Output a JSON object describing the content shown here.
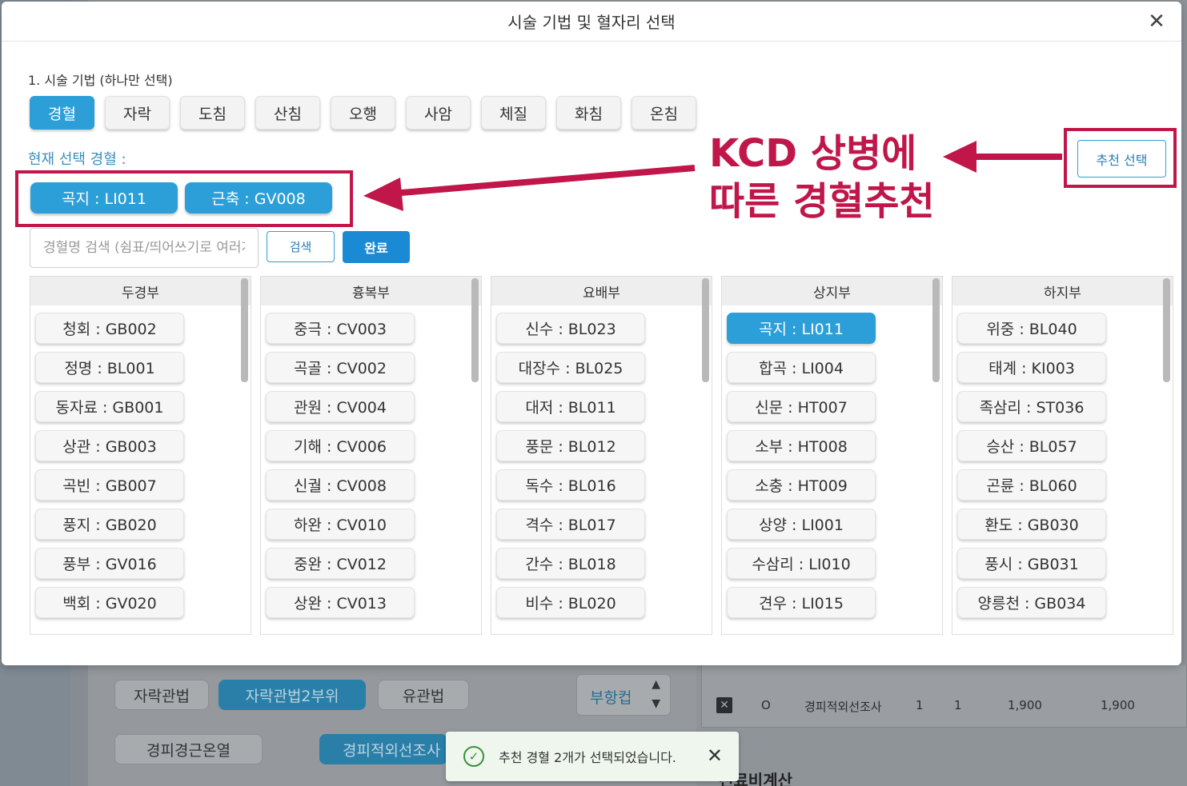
{
  "modal": {
    "title": "시술 기법 및 혈자리 선택",
    "close_icon": "✕"
  },
  "techniques": {
    "label": "1. 시술 기법 (하나만 선택)",
    "items": [
      "경혈",
      "자락",
      "도침",
      "산침",
      "오행",
      "사암",
      "체질",
      "화침",
      "온침"
    ],
    "selected": "경혈"
  },
  "current_selection": {
    "label": "현재 선택 경혈 :",
    "chips": [
      "곡지 : LI011",
      "근축 : GV008"
    ]
  },
  "annotation": {
    "line1": "KCD 상병에",
    "line2": "따른 경혈추천",
    "color": "#c0164a"
  },
  "recommend_button": "추천 선택",
  "search": {
    "placeholder": "경혈명 검색 (쉼표/띄어쓰기로 여러개 검색)",
    "search_label": "검색",
    "done_label": "완료"
  },
  "columns": [
    {
      "title": "두경부",
      "items": [
        "청회 : GB002",
        "정명 : BL001",
        "동자료 : GB001",
        "상관 : GB003",
        "곡빈 : GB007",
        "풍지 : GB020",
        "풍부 : GV016",
        "백회 : GV020"
      ]
    },
    {
      "title": "흉복부",
      "items": [
        "중극 : CV003",
        "곡골 : CV002",
        "관원 : CV004",
        "기해 : CV006",
        "신궐 : CV008",
        "하완 : CV010",
        "중완 : CV012",
        "상완 : CV013"
      ]
    },
    {
      "title": "요배부",
      "items": [
        "신수 : BL023",
        "대장수 : BL025",
        "대저 : BL011",
        "풍문 : BL012",
        "독수 : BL016",
        "격수 : BL017",
        "간수 : BL018",
        "비수 : BL020"
      ]
    },
    {
      "title": "상지부",
      "items": [
        "곡지 : LI011",
        "합곡 : LI004",
        "신문 : HT007",
        "소부 : HT008",
        "소충 : HT009",
        "상양 : LI001",
        "수삼리 : LI010",
        "견우 : LI015"
      ],
      "active": "곡지 : LI011"
    },
    {
      "title": "하지부",
      "items": [
        "위중 : BL040",
        "태계 : KI003",
        "족삼리 : ST036",
        "승산 : BL057",
        "곤륜 : BL060",
        "환도 : GB030",
        "풍시 : GB031",
        "양릉천 : GB034"
      ]
    }
  ],
  "background": {
    "buttons_row1": [
      "자락관법",
      "자락관법2부위",
      "유관법"
    ],
    "stepper_label": "부항컵",
    "buttons_row2": [
      "경피경근온열",
      "경피적외선조사"
    ],
    "table_row": {
      "check": "✕",
      "mark": "O",
      "name": "경피적외선조사",
      "qty1": "1",
      "qty2": "1",
      "price": "1,900",
      "total": "1,900"
    },
    "heading": "진료비계산"
  },
  "toast": {
    "message": "추천 경혈 2개가 선택되었습니다.",
    "icon": "✓",
    "close_icon": "✕"
  }
}
